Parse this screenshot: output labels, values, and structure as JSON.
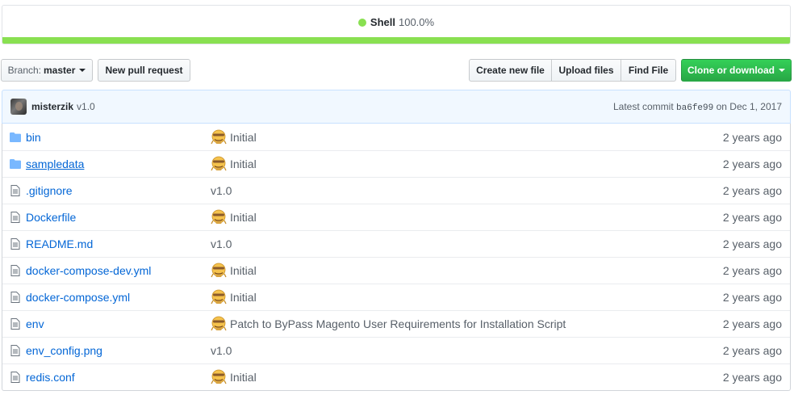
{
  "languages": {
    "name": "Shell",
    "percent": "100.0%",
    "color": "#89e051"
  },
  "toolbar": {
    "branch_prefix": "Branch:",
    "branch_name": "master",
    "new_pr": "New pull request",
    "create_file": "Create new file",
    "upload_files": "Upload files",
    "find_file": "Find File",
    "clone": "Clone or download"
  },
  "commit": {
    "author": "misterzik",
    "message": "v1.0",
    "prefix": "Latest commit",
    "sha": "ba6fe99",
    "date": "on Dec 1, 2017"
  },
  "files": [
    {
      "name": "bin",
      "type": "dir",
      "message": "Initial",
      "emoji": true,
      "age": "2 years ago"
    },
    {
      "name": "sampledata",
      "type": "dir",
      "message": "Initial",
      "emoji": true,
      "age": "2 years ago"
    },
    {
      "name": ".gitignore",
      "type": "file",
      "message": "v1.0",
      "emoji": false,
      "age": "2 years ago"
    },
    {
      "name": "Dockerfile",
      "type": "file",
      "message": "Initial",
      "emoji": true,
      "age": "2 years ago"
    },
    {
      "name": "README.md",
      "type": "file",
      "message": "v1.0",
      "emoji": false,
      "age": "2 years ago"
    },
    {
      "name": "docker-compose-dev.yml",
      "type": "file",
      "message": "Initial",
      "emoji": true,
      "age": "2 years ago"
    },
    {
      "name": "docker-compose.yml",
      "type": "file",
      "message": "Initial",
      "emoji": true,
      "age": "2 years ago"
    },
    {
      "name": "env",
      "type": "file",
      "message": "Patch to ByPass Magento User Requirements for Installation Script",
      "emoji": true,
      "age": "2 years ago"
    },
    {
      "name": "env_config.png",
      "type": "file",
      "message": "v1.0",
      "emoji": false,
      "age": "2 years ago"
    },
    {
      "name": "redis.conf",
      "type": "file",
      "message": "Initial",
      "emoji": true,
      "age": "2 years ago"
    }
  ]
}
